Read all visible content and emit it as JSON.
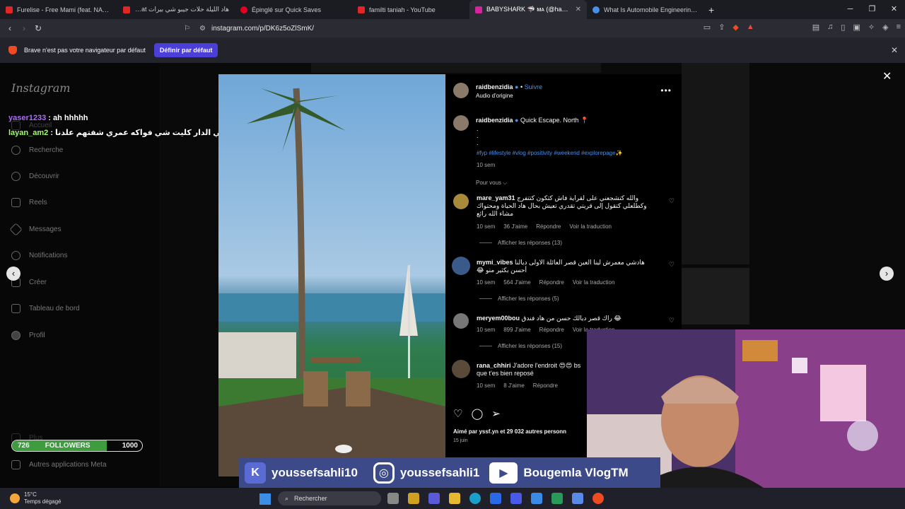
{
  "tabs": [
    {
      "title": "Furelise - Free Mami (feat. NAB FAKE",
      "color": "#e32525",
      "active": false
    },
    {
      "title": "هاد الليلة حلات جيبو شي بيرات bo birat",
      "color": "#e32525",
      "active": false
    },
    {
      "title": "Épinglé sur Quick Saves",
      "color": "#e60023",
      "active": false
    },
    {
      "title": "familti taniah - YouTube",
      "color": "#e32525",
      "active": false
    },
    {
      "title": "BABYSHARK 🦈 ᴍᴀ (@hanaebel",
      "color": "#d6249f",
      "active": true
    },
    {
      "title": "What Is Automobile Engineering? | In",
      "color": "#4a8fe8",
      "active": false
    }
  ],
  "address": {
    "url": "instagram.com/p/DK6z5oZlSmK/"
  },
  "infobar": {
    "message": "Brave n'est pas votre navigateur par défaut",
    "button": "Définir par défaut"
  },
  "sidebar": {
    "logo": "Instagram",
    "items": [
      "Accueil",
      "Recherche",
      "Découvrir",
      "Reels",
      "Messages",
      "Notifications",
      "Créer",
      "Tableau de bord",
      "Profil",
      "Plus",
      "Autres applications Meta"
    ]
  },
  "chat": [
    {
      "user": "yaser1233",
      "message": "ah hhhhh"
    },
    {
      "user": "layan_am2",
      "message": "ياك سالات علدنا عراضة في الدار كليت شي فواكه عمري شفتهم علدنا"
    }
  ],
  "followers": {
    "current": "726",
    "label": "FOLLOWERS",
    "goal": "1000",
    "progress": 0.726
  },
  "post": {
    "author": "raidbenzidia",
    "follow": "Suivre",
    "audio": "Audio d'origine",
    "caption_title": "Quick Escape. North 📍",
    "caption_dots": [
      ".",
      ".",
      "."
    ],
    "hashtags": "#fyp #lifestyle #vlog #positivity #weekend #explorepage✨",
    "time": "10 sem",
    "pour_vous": "Pour vous ⌵",
    "comments": [
      {
        "user": "mare_yam31",
        "text": "والله كتشجعني على لقراية فاش كتكون كتتفرج وكطلعلي كتقول إلى قريتي تقدري تعيش بحال هاد الحياة ومحتواك مشاء الله رائع",
        "time": "10 sem",
        "likes": "36 J'aime",
        "reply": "Répondre",
        "translate": "Voir la traduction",
        "replies": "Afficher les réponses (13)"
      },
      {
        "user": "mymi_vibes",
        "text": "هادشي معمرش لينا العين قصر العائلة الاولى ديالنا أحسن بكثير منو 😂",
        "time": "10 sem",
        "likes": "564 J'aime",
        "reply": "Répondre",
        "translate": "Voir la traduction",
        "replies": "Afficher les réponses (5)"
      },
      {
        "user": "meryem00bou",
        "text": "😂 راك قصر ديالك حسن من هاد فندق",
        "time": "10 sem",
        "likes": "899 J'aime",
        "reply": "Répondre",
        "translate": "Voir la traduction",
        "replies": "Afficher les réponses (15)"
      },
      {
        "user": "rana_chhiri",
        "text": "J'adore l'endroit 😍😍 bs que t'es bien reposé",
        "time": "10 sem",
        "likes": "8 J'aime",
        "reply": "Répondre",
        "translate": "",
        "replies": ""
      }
    ],
    "liked_by": "Aimé par yssf.yn et 29 032 autres personn",
    "date": "15 juin"
  },
  "banner": [
    {
      "icon": "K",
      "handle": "youssefsahli10",
      "color": "#5b6bd6"
    },
    {
      "icon": "◎",
      "handle": "youssefsahli1",
      "color": "#3d4a8a"
    },
    {
      "icon": "▶",
      "handle": "Bougemla VlogTM",
      "color": "#ffffff"
    }
  ],
  "taskbar": {
    "temp": "15°C",
    "weather": "Temps dégagé",
    "search": "Rechercher"
  }
}
